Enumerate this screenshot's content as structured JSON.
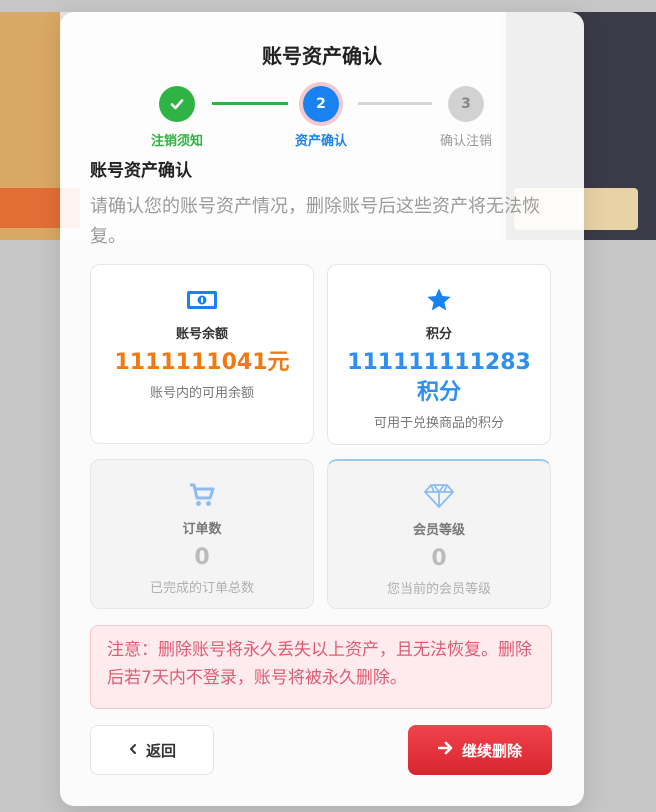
{
  "modal": {
    "title": "账号资产确认"
  },
  "steps": [
    {
      "number": "✓",
      "label": "注销须知"
    },
    {
      "number": "2",
      "label": "资产确认"
    },
    {
      "number": "3",
      "label": "确认注销"
    }
  ],
  "section": {
    "title": "账号资产确认",
    "description": "请确认您的账号资产情况，删除账号后这些资产将无法恢复。"
  },
  "assets": {
    "balance": {
      "name": "账号余额",
      "value": "1111111041元",
      "desc": "账号内的可用余额",
      "icon": "money-icon"
    },
    "points": {
      "name": "积分",
      "value": "111111111283积分",
      "desc": "可用于兑换商品的积分",
      "icon": "star-icon"
    },
    "orders": {
      "name": "订单数",
      "value": "0",
      "desc": "已完成的订单总数",
      "icon": "cart-icon"
    },
    "level": {
      "name": "会员等级",
      "value": "0",
      "desc": "您当前的会员等级",
      "icon": "diamond-icon"
    }
  },
  "warning": {
    "text": "注意：删除账号将永久丢失以上资产，且无法恢复。删除后若7天内不登录，账号将被永久删除。"
  },
  "buttons": {
    "back": "返回",
    "continue": "继续删除"
  },
  "colors": {
    "success": "#2fb344",
    "primary": "#1a82f0",
    "balance": "#f07a12",
    "points": "#2d8ff0",
    "danger": "#e0303a"
  }
}
